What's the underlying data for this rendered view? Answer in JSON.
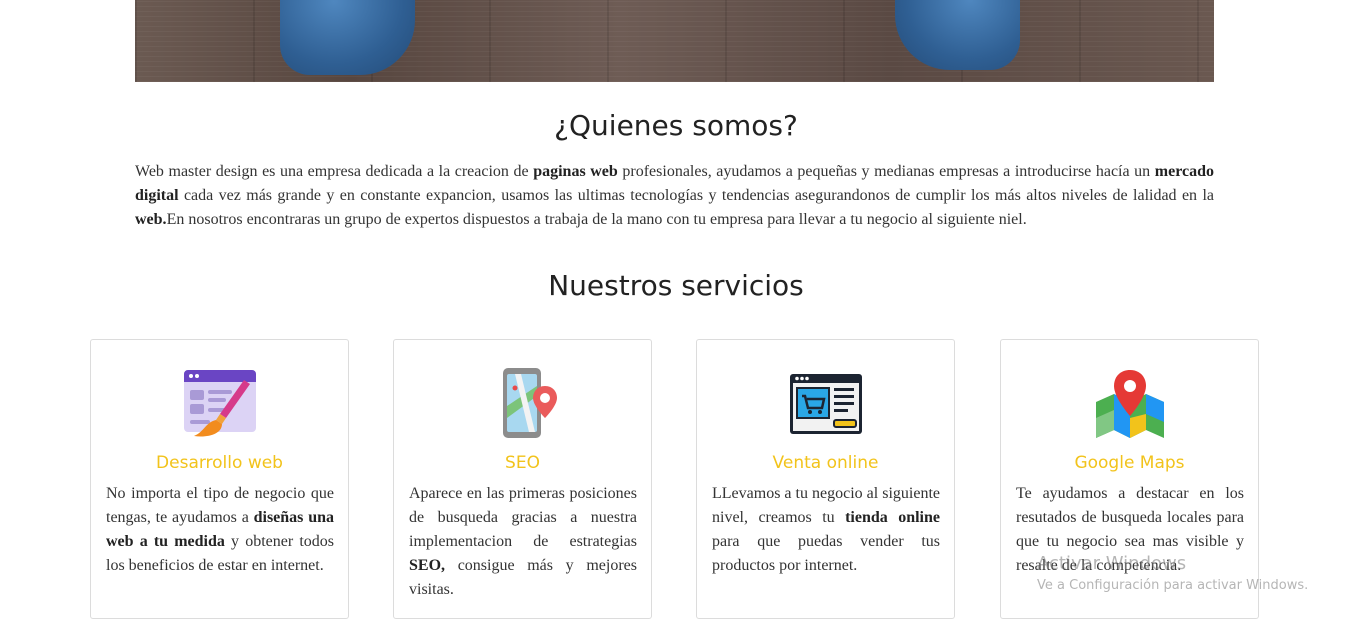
{
  "about": {
    "title": "¿Quienes somos?",
    "text_parts": [
      "Web master design es una empresa dedicada a la creacion de ",
      "paginas web",
      " profesionales, ayudamos a pequeñas y medianas empresas a introducirse hacía un ",
      "mercado digital",
      " cada vez más grande y en constante expancion, usamos las ultimas tecnologías y tendencias asegurandonos de cumplir los más altos niveles de lalidad en la ",
      "web.",
      "En nosotros encontraras un grupo de expertos dispuestos a trabaja de la mano con tu empresa para llevar a tu negocio al siguiente niel."
    ]
  },
  "services": {
    "title": "Nuestros servicios",
    "cards": [
      {
        "icon": "web-design-icon",
        "title": "Desarrollo web",
        "text_parts": [
          "No importa el tipo de negocio que tengas, te ayudamos a ",
          "diseñas una web a tu medida",
          " y obtener todos los beneficios de estar en internet."
        ]
      },
      {
        "icon": "map-phone-icon",
        "title": "SEO",
        "text_parts": [
          "Aparece en las primeras posiciones de busqueda gracias a nuestra implementacion de estrategias ",
          "SEO,",
          " consigue más y mejores visitas."
        ]
      },
      {
        "icon": "online-store-icon",
        "title": "Venta online",
        "text_parts": [
          "LLevamos a tu negocio al siguiente nivel, creamos tu ",
          "tienda online",
          " para que puedas vender tus productos por internet."
        ]
      },
      {
        "icon": "map-pin-icon",
        "title": "Google Maps",
        "text_parts": [
          "Te ayudamos a destacar en los resutados de busqueda locales para que tu negocio sea mas visible y resalte de la competencia."
        ]
      }
    ]
  },
  "watermark": {
    "title": "Activar Windows",
    "subtitle": "Ve a Configuración para activar Windows."
  },
  "colors": {
    "service_title": "#f2c31b",
    "heading": "#222222",
    "body_text": "#333333",
    "card_border": "#dcdcdc"
  }
}
